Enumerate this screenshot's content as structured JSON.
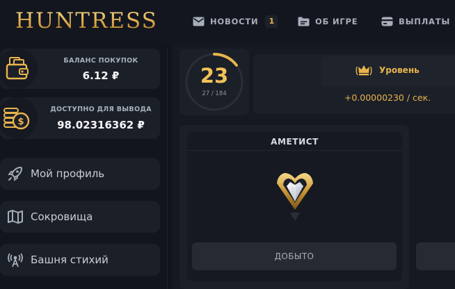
{
  "app": {
    "logo": "HUNTRESS"
  },
  "nav": {
    "news_label": "НОВОСТИ",
    "news_badge": "1",
    "about_label": "ОБ ИГРЕ",
    "payouts_label": "ВЫПЛАТЫ"
  },
  "sidebar": {
    "purchase_balance": {
      "label": "БАЛАНС ПОКУПОК",
      "value": "6.12 ₽"
    },
    "withdraw_balance": {
      "label": "ДОСТУПНО ДЛЯ ВЫВОДА",
      "value": "98.02316362 ₽"
    },
    "items": [
      {
        "label": "Мой профиль",
        "icon": "rocket-icon"
      },
      {
        "label": "Сокровища",
        "icon": "map-icon"
      },
      {
        "label": "Башня стихий",
        "icon": "tower-icon"
      }
    ]
  },
  "level": {
    "number": "23",
    "progress_text": "27 / 184",
    "progress_fraction": 0.147,
    "rank_title": "Уровень",
    "rate": "+0.00000230 / сек."
  },
  "gem": {
    "title": "АМЕТИСТ",
    "button_label": "ДОБЫТО"
  },
  "colors": {
    "accent": "#e9b44c",
    "background": "#12151d",
    "card": "#1b1f28"
  }
}
